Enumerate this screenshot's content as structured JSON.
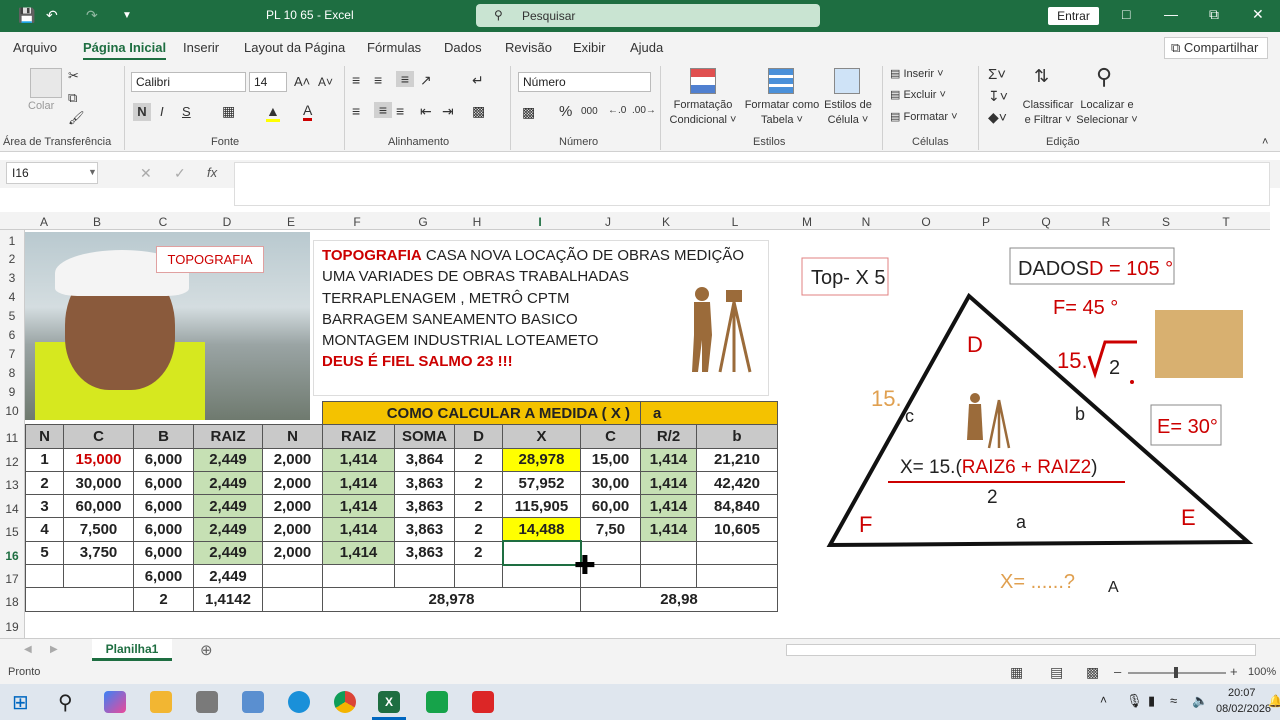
{
  "window": {
    "file_title": "PL 10 65",
    "app_name": "Excel",
    "search_placeholder": "Pesquisar",
    "signin_label": "Entrar"
  },
  "menu": {
    "tabs": [
      "Arquivo",
      "Página Inicial",
      "Inserir",
      "Layout da Página",
      "Fórmulas",
      "Dados",
      "Revisão",
      "Exibir",
      "Ajuda"
    ],
    "share_label": "Compartilhar"
  },
  "ribbon": {
    "paste_label": "Colar",
    "font_name": "Calibri",
    "font_size": "14",
    "number_format": "Número",
    "bold": "N",
    "italic": "I",
    "underline": "S",
    "conditional_label_1": "Formatação",
    "conditional_label_2": "Condicional",
    "format_table_1": "Formatar como",
    "format_table_2": "Tabela",
    "cell_styles_1": "Estilos de",
    "cell_styles_2": "Célula",
    "insert_label": "Inserir",
    "delete_label": "Excluir",
    "format_label": "Formatar",
    "sort_1": "Classificar",
    "sort_2": "e Filtrar",
    "find_1": "Localizar e",
    "find_2": "Selecionar",
    "groups": {
      "clipboard": "Área de Transferência",
      "font": "Fonte",
      "alignment": "Alinhamento",
      "number": "Número",
      "styles": "Estilos",
      "cells": "Células",
      "editing": "Edição"
    }
  },
  "formula_bar": {
    "name_box": "I16",
    "fx": "fx",
    "content": ""
  },
  "columns": [
    "A",
    "B",
    "C",
    "D",
    "E",
    "F",
    "G",
    "H",
    "I",
    "J",
    "K",
    "L",
    "M",
    "N",
    "O",
    "P",
    "Q",
    "R",
    "S",
    "T"
  ],
  "rows": [
    "1",
    "2",
    "3",
    "4",
    "5",
    "6",
    "7",
    "8",
    "9",
    "10",
    "11",
    "12",
    "13",
    "14",
    "15",
    "16",
    "17",
    "18",
    "19"
  ],
  "sheet_content": {
    "topo_label": "TOPOGRAFIA",
    "text_lines": [
      {
        "red": "TOPOGRAFIA",
        "rest": " CASA NOVA LOCAÇÃO DE OBRAS MEDIÇÃO"
      },
      {
        "red": "",
        "rest": "UMA VARIADES DE OBRAS TRABALHADAS"
      },
      {
        "red": "",
        "rest": "TERRAPLENAGEM , METRÔ CPTM"
      },
      {
        "red": "",
        "rest": "BARRAGEM SANEAMENTO BASICO"
      },
      {
        "red": "",
        "rest": "MONTAGEM INDUSTRIAL LOTEAMETO"
      },
      {
        "red": "DEUS É FIEL SALMO 23 !!!",
        "rest": ""
      }
    ],
    "table_title": "COMO CALCULAR A MEDIDA  ( X )",
    "table_title_a": "a",
    "headers": [
      "N",
      "C",
      "B",
      "RAIZ",
      "N",
      "RAIZ",
      "SOMA",
      "D",
      "X",
      "C",
      "R/2",
      "b"
    ],
    "data_rows": [
      [
        "1",
        "15,000",
        "6,000",
        "2,449",
        "2,000",
        "1,414",
        "3,864",
        "2",
        "28,978",
        "15,00",
        "1,414",
        "21,210"
      ],
      [
        "2",
        "30,000",
        "6,000",
        "2,449",
        "2,000",
        "1,414",
        "3,863",
        "2",
        "57,952",
        "30,00",
        "1,414",
        "42,420"
      ],
      [
        "3",
        "60,000",
        "6,000",
        "2,449",
        "2,000",
        "1,414",
        "3,863",
        "2",
        "115,905",
        "60,00",
        "1,414",
        "84,840"
      ],
      [
        "4",
        "7,500",
        "6,000",
        "2,449",
        "2,000",
        "1,414",
        "3,863",
        "2",
        "14,488",
        "7,50",
        "1,414",
        "10,605"
      ],
      [
        "5",
        "3,750",
        "6,000",
        "2,449",
        "2,000",
        "1,414",
        "3,863",
        "2",
        "",
        "",
        "",
        ""
      ]
    ],
    "row17": [
      "",
      "",
      "6,000",
      "2,449"
    ],
    "row18": {
      "c": "2",
      "d": "1,4142",
      "mid": "28,978",
      "right": "28,98"
    }
  },
  "diagram": {
    "top_label": "Top- X 5",
    "dados": "DADOS",
    "d_value": "D = 105 °",
    "f_value": "F= 45 °",
    "e_value": "E= 30°",
    "vertex_d": "D",
    "vertex_f": "F",
    "vertex_e": "E",
    "side_c": "c",
    "side_b": "b",
    "side_a": "a",
    "side_c_value": "15.",
    "side_b_value": "15.",
    "sqrt_value": "2",
    "formula_x": "X= 15.(",
    "formula_raiz": "RAIZ6 + RAIZ2",
    "formula_close": ")",
    "denominator": "2",
    "question_x": "X= ......?",
    "question_a": "A"
  },
  "sheet_tab": "Planilha1",
  "status": {
    "ready": "Pronto",
    "zoom": "100%"
  },
  "taskbar": {
    "time": "20:07",
    "date": "08/02/2026"
  }
}
